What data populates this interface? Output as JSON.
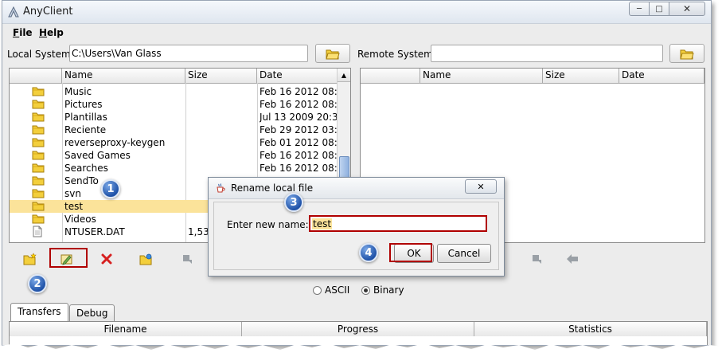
{
  "window": {
    "title": "AnyClient"
  },
  "menu": {
    "file": "File",
    "help": "Help",
    "file_accel": "F",
    "file_rest": "ile",
    "help_accel": "H",
    "help_rest": "elp"
  },
  "local": {
    "label": "Local System",
    "path": "C:\\Users\\Van Glass",
    "columns": [
      "Name",
      "Size",
      "Date"
    ],
    "rows": [
      {
        "icon": "folder",
        "name": "Music",
        "size": "",
        "date": "Feb 16 2012 08:..."
      },
      {
        "icon": "folder",
        "name": "Pictures",
        "size": "",
        "date": "Feb 16 2012 08:..."
      },
      {
        "icon": "folder",
        "name": "Plantillas",
        "size": "",
        "date": "Jul 13 2009 20:3..."
      },
      {
        "icon": "folder",
        "name": "Reciente",
        "size": "",
        "date": "Feb 29 2012 03:..."
      },
      {
        "icon": "folder",
        "name": "reverseproxy-keygen",
        "size": "",
        "date": "Feb 01 2012 08:..."
      },
      {
        "icon": "folder",
        "name": "Saved Games",
        "size": "",
        "date": "Feb 16 2012 08:..."
      },
      {
        "icon": "folder",
        "name": "Searches",
        "size": "",
        "date": "Feb 16 2012 08:..."
      },
      {
        "icon": "folder",
        "name": "SendTo",
        "size": "",
        "date": ""
      },
      {
        "icon": "folder",
        "name": "svn",
        "size": "",
        "date": ""
      },
      {
        "icon": "folder",
        "name": "test",
        "size": "",
        "date": "",
        "selected": true
      },
      {
        "icon": "folder",
        "name": "Videos",
        "size": "",
        "date": ""
      },
      {
        "icon": "file",
        "name": "NTUSER.DAT",
        "size": "1,536",
        "date": ""
      }
    ]
  },
  "remote": {
    "label": "Remote System",
    "path": "",
    "columns": [
      "Name",
      "Size",
      "Date"
    ]
  },
  "transfer_mode": {
    "ascii": "ASCII",
    "binary": "Binary",
    "selected": "binary"
  },
  "tabs": [
    {
      "label": "Transfers",
      "active": true
    },
    {
      "label": "Debug",
      "active": false
    }
  ],
  "transfers_columns": [
    "Filename",
    "Progress",
    "Statistics"
  ],
  "dialog": {
    "title": "Rename local file",
    "prompt": "Enter new name:",
    "value": "test",
    "ok": "OK",
    "cancel": "Cancel"
  },
  "callouts": [
    "1",
    "2",
    "3",
    "4"
  ],
  "colors": {
    "selection": "#fbe39a",
    "callout": "#1f52a8",
    "highlight_border": "#b00000"
  }
}
